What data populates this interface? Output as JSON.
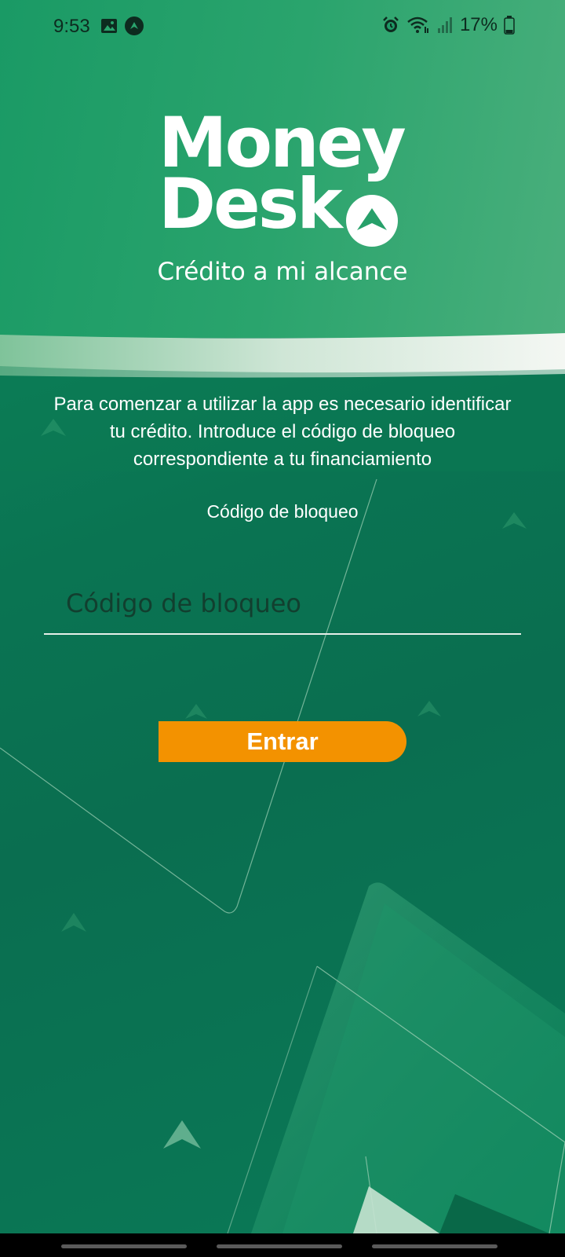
{
  "status_bar": {
    "time": "9:53",
    "battery": "17%",
    "icons": [
      "image-icon",
      "app-notification-icon",
      "alarm-icon",
      "wifi-icon",
      "signal-icon",
      "battery-icon"
    ]
  },
  "brand": {
    "line1": "Money",
    "line2": "Desk",
    "tagline": "Crédito a mi alcance",
    "colors": {
      "primary_green": "#0a7a55",
      "header_green": "#2aa46d",
      "accent_orange": "#f39200"
    }
  },
  "intro": {
    "text": "Para comenzar a utilizar la app es necesario identificar tu crédito. Introduce el código de bloqueo correspondiente a tu financiamiento"
  },
  "form": {
    "code_label": "Código de bloqueo",
    "code_placeholder": "Código de bloqueo",
    "code_value": "",
    "submit_label": "Entrar"
  },
  "nav_bar": {
    "items": [
      "recent-apps",
      "home",
      "back"
    ]
  }
}
